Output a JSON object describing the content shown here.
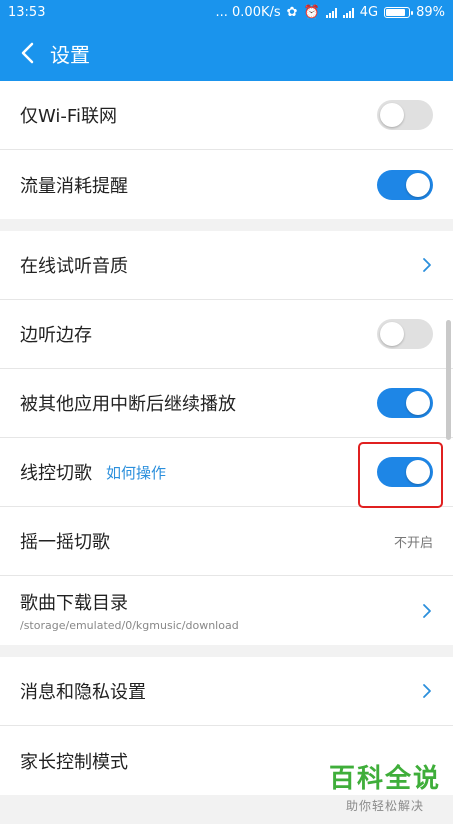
{
  "status": {
    "time": "13:53",
    "network_speed": "... 0.00K/s",
    "network_type": "4G",
    "battery": "89%"
  },
  "header": {
    "title": "设置"
  },
  "rows": [
    {
      "label": "仅Wi-Fi联网",
      "toggle": "off"
    },
    {
      "label": "流量消耗提醒",
      "toggle": "on"
    },
    {
      "label": "在线试听音质",
      "chevron": true
    },
    {
      "label": "边听边存",
      "toggle": "off"
    },
    {
      "label": "被其他应用中断后继续播放",
      "toggle": "on"
    },
    {
      "label": "线控切歌",
      "link": "如何操作",
      "toggle": "on"
    },
    {
      "label": "摇一摇切歌",
      "value": "不开启"
    },
    {
      "label": "歌曲下载目录",
      "sub": "/storage/emulated/0/kgmusic/download",
      "chevron": true
    },
    {
      "label": "消息和隐私设置",
      "chevron": true
    },
    {
      "label": "家长控制模式"
    }
  ],
  "watermark": {
    "main": "百科全说",
    "sub": "助你轻松解决"
  },
  "colors": {
    "accent": "#1a94ed",
    "toggle_on": "#1e86e6",
    "highlight": "#e02020",
    "watermark": "#3fae3a"
  }
}
